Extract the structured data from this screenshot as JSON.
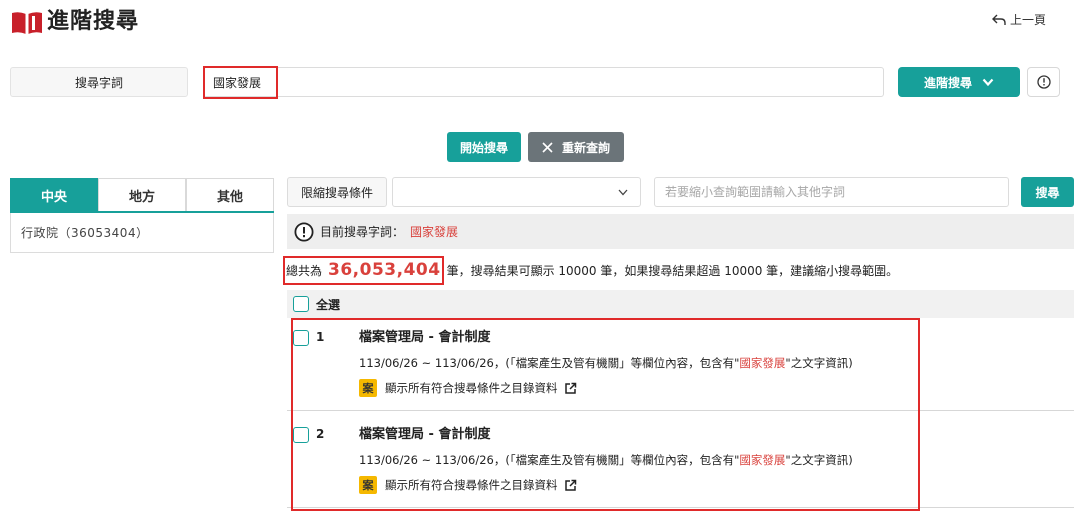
{
  "header": {
    "title": "進階搜尋",
    "back_label": "上一頁"
  },
  "search": {
    "field_label": "搜尋字詞",
    "keyword": "國家發展",
    "advanced_label": "進階搜尋",
    "start_label": "開始搜尋",
    "reset_label": "重新查詢"
  },
  "tabs": [
    {
      "label": "中央",
      "active": true
    },
    {
      "label": "地方",
      "active": false
    },
    {
      "label": "其他",
      "active": false
    }
  ],
  "agencies": [
    {
      "label": "行政院（36053404）"
    }
  ],
  "filter": {
    "label": "限縮搜尋條件",
    "selected": "",
    "narrow_placeholder": "若要縮小查詢範圍請輸入其他字詞",
    "narrow_button": "搜尋"
  },
  "current": {
    "prefix": "目前搜尋字詞：",
    "term": "國家發展"
  },
  "total": {
    "prefix": "總共為",
    "count": "36,053,404",
    "suffix": "筆",
    "note": "，搜尋結果可顯示 10000 筆，如果搜尋結果超過 10000 筆，建議縮小搜尋範圍。"
  },
  "select_all_label": "全選",
  "results": [
    {
      "index": "1",
      "title": "檔案管理局 - 會計制度",
      "desc_before": "113/06/26 ~ 113/06/26，(「檔案產生及管有機關」等欄位內容，包含有\"",
      "desc_term": "國家發展",
      "desc_after": "\"之文字資訊)",
      "badge": "案",
      "link_label": "顯示所有符合搜尋條件之目錄資料"
    },
    {
      "index": "2",
      "title": "檔案管理局 - 會計制度",
      "desc_before": "113/06/26 ~ 113/06/26，(「檔案產生及管有機關」等欄位內容，包含有\"",
      "desc_term": "國家發展",
      "desc_after": "\"之文字資訊)",
      "badge": "案",
      "link_label": "顯示所有符合搜尋條件之目錄資料"
    }
  ],
  "colors": {
    "accent": "#17a09a",
    "highlight": "#d9413c",
    "badge": "#f5b800",
    "annotation": "#e02a2a"
  }
}
